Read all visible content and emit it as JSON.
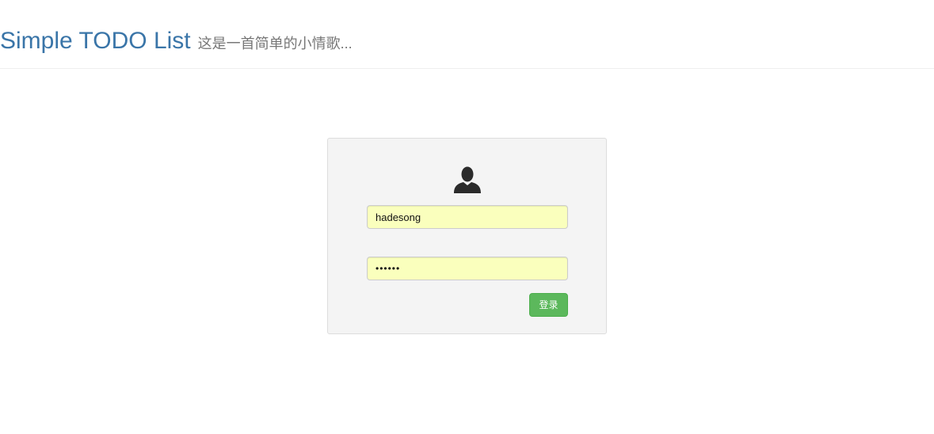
{
  "header": {
    "title": "Simple TODO List",
    "subtitle": "这是一首简单的小情歌..."
  },
  "login": {
    "icon": "user-icon",
    "username_value": "hadesong",
    "password_value": "••••••",
    "submit_label": "登录"
  },
  "colors": {
    "brand": "#3a75a8",
    "panel_background": "#f4f4f4",
    "autofill_background": "#faffbd",
    "button_green": "#5cb85c"
  }
}
